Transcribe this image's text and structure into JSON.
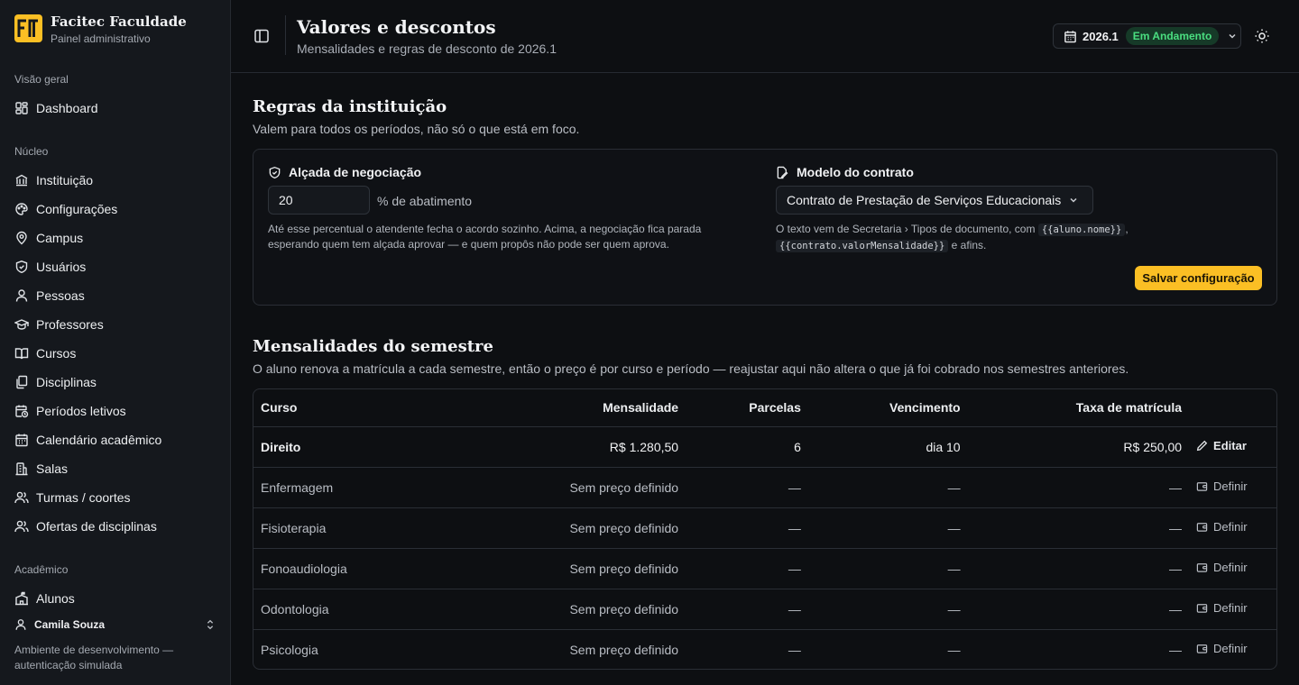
{
  "sidebar": {
    "brand": {
      "name": "Facitec Faculdade",
      "subtitle": "Painel administrativo",
      "accent": "#fbbf24"
    },
    "sections": [
      {
        "label": "Visão geral",
        "items": [
          {
            "label": "Dashboard",
            "icon": "dashboard-icon"
          }
        ]
      },
      {
        "label": "Núcleo",
        "items": [
          {
            "label": "Instituição",
            "icon": "institution-icon"
          },
          {
            "label": "Configurações",
            "icon": "palette-icon"
          },
          {
            "label": "Campus",
            "icon": "map-pin-icon"
          },
          {
            "label": "Usuários",
            "icon": "shield-icon"
          },
          {
            "label": "Pessoas",
            "icon": "user-icon"
          },
          {
            "label": "Professores",
            "icon": "graduation-cap-icon"
          },
          {
            "label": "Cursos",
            "icon": "book-open-icon"
          },
          {
            "label": "Disciplinas",
            "icon": "documents-icon"
          },
          {
            "label": "Períodos letivos",
            "icon": "calendar-clock-icon"
          },
          {
            "label": "Calendário acadêmico",
            "icon": "calendar-icon"
          },
          {
            "label": "Salas",
            "icon": "building-icon"
          },
          {
            "label": "Turmas / coortes",
            "icon": "users-icon"
          },
          {
            "label": "Ofertas de disciplinas",
            "icon": "users-icon"
          }
        ]
      },
      {
        "label": "Acadêmico",
        "items": [
          {
            "label": "Alunos",
            "icon": "school-icon"
          }
        ]
      }
    ],
    "user": {
      "name": "Camila Souza"
    },
    "env_note": "Ambiente de desenvolvimento — autenticação simulada"
  },
  "header": {
    "title": "Valores e descontos",
    "subtitle": "Mensalidades e regras de desconto de 2026.1",
    "period": {
      "value": "2026.1",
      "status": "Em Andamento",
      "status_color": "#4ade80"
    }
  },
  "rules": {
    "title": "Regras da instituição",
    "subtitle": "Valem para todos os períodos, não só o que está em foco.",
    "negotiation": {
      "label": "Alçada de negociação",
      "value": "20",
      "unit": "% de abatimento",
      "help": "Até esse percentual o atendente fecha o acordo sozinho. Acima, a negociação fica parada esperando quem tem alçada aprovar — e quem propôs não pode ser quem aprova."
    },
    "contract": {
      "label": "Modelo do contrato",
      "selected": "Contrato de Prestação de Serviços Educacionais",
      "help_prefix": "O texto vem de Secretaria › Tipos de documento, com",
      "code1": "{{aluno.nome}}",
      "code2": "{{contrato.valorMensalidade}}",
      "help_suffix": "e afins."
    },
    "save_label": "Salvar configuração"
  },
  "fees": {
    "title": "Mensalidades do semestre",
    "subtitle": "O aluno renova a matrícula a cada semestre, então o preço é por curso e período — reajustar aqui não altera o que já foi cobrado nos semestres anteriores.",
    "columns": [
      "Curso",
      "Mensalidade",
      "Parcelas",
      "Vencimento",
      "Taxa de matrícula"
    ],
    "rows": [
      {
        "course": "Direito",
        "fee": "R$ 1.280,50",
        "installments": "6",
        "due": "dia 10",
        "enrollment": "R$ 250,00",
        "action": "Editar",
        "set": true
      },
      {
        "course": "Enfermagem",
        "fee": "Sem preço definido",
        "installments": "—",
        "due": "—",
        "enrollment": "—",
        "action": "Definir",
        "set": false
      },
      {
        "course": "Fisioterapia",
        "fee": "Sem preço definido",
        "installments": "—",
        "due": "—",
        "enrollment": "—",
        "action": "Definir",
        "set": false
      },
      {
        "course": "Fonoaudiologia",
        "fee": "Sem preço definido",
        "installments": "—",
        "due": "—",
        "enrollment": "—",
        "action": "Definir",
        "set": false
      },
      {
        "course": "Odontologia",
        "fee": "Sem preço definido",
        "installments": "—",
        "due": "—",
        "enrollment": "—",
        "action": "Definir",
        "set": false
      },
      {
        "course": "Psicologia",
        "fee": "Sem preço definido",
        "installments": "—",
        "due": "—",
        "enrollment": "—",
        "action": "Definir",
        "set": false
      }
    ]
  }
}
